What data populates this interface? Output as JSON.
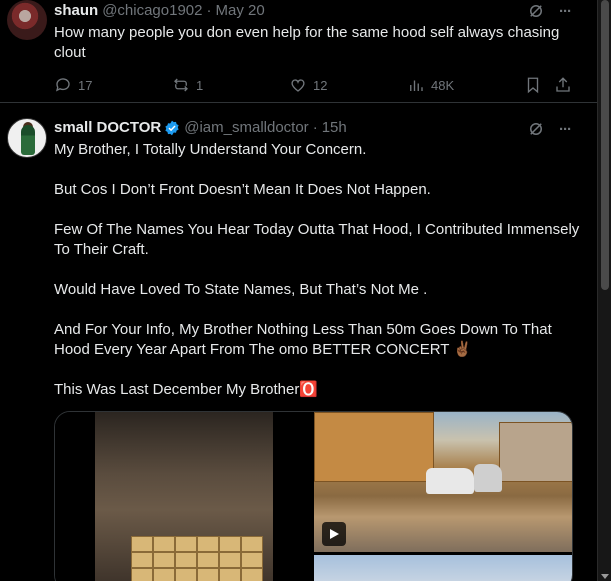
{
  "tweet1": {
    "name": "shaun",
    "handle": "@chicago1902",
    "separator": "·",
    "date": "May 20",
    "text": "How many people you don even help for the same hood self always chasing clout",
    "replies": "17",
    "retweets": "1",
    "likes": "12",
    "views": "48K",
    "more_label": "···"
  },
  "tweet2": {
    "name": "small DOCTOR",
    "handle": "@iam_smalldoctor",
    "separator": "·",
    "date": "15h",
    "more_label": "···",
    "paragraphs": [
      "My Brother, I Totally Understand Your Concern.",
      "But Cos I Don’t Front Doesn’t Mean It Does Not Happen.",
      "Few Of The Names You Hear Today Outta That Hood, I Contributed Immensely To Their Craft.",
      "Would Have Loved To State Names, But That’s Not Me .",
      "And For Your Info, My Brother Nothing Less Than 50m Goes Down To That Hood Every Year Apart From The omo BETTER CONCERT ✌🏾",
      "This Was Last December My Brother🅾️"
    ]
  },
  "colors": {
    "background": "#000000",
    "text": "#e7e9ea",
    "muted": "#71767b",
    "verified": "#1d9bf0",
    "divider": "#2f3336"
  }
}
